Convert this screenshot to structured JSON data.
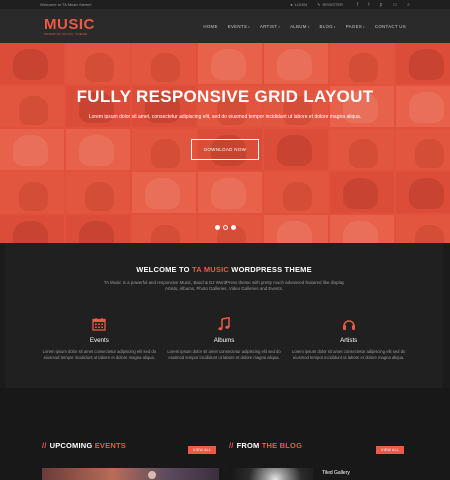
{
  "topbar": {
    "welcome": "Welcome to TA Music theme!",
    "login": "LOGIN",
    "register": "REGISTER",
    "social": [
      {
        "icon": "facebook-icon",
        "glyph": "f"
      },
      {
        "icon": "twitter-icon",
        "glyph": "t"
      },
      {
        "icon": "pinterest-icon",
        "glyph": "p"
      },
      {
        "icon": "cart-icon",
        "glyph": "▭"
      },
      {
        "icon": "search-icon",
        "glyph": "⌕"
      }
    ]
  },
  "header": {
    "logo": "MUSIC",
    "tagline": "PREMIUM MUSIC THEME"
  },
  "nav": [
    {
      "label": "HOME",
      "dropdown": false
    },
    {
      "label": "EVENTS",
      "dropdown": true
    },
    {
      "label": "ARTIST",
      "dropdown": true
    },
    {
      "label": "ALBUM",
      "dropdown": true
    },
    {
      "label": "BLOG",
      "dropdown": true
    },
    {
      "label": "PAGES",
      "dropdown": true
    },
    {
      "label": "CONTACT US",
      "dropdown": false
    }
  ],
  "hero": {
    "title": "FULLY RESPONSIVE GRID LAYOUT",
    "subtitle": "Lorem ipsum dolor sit amet, consectetur adipiscing elit, sed do eiusmod tempor incididunt ut labore et dolore magna aliqua.",
    "button": "DOWNLOAD NOW",
    "slides": 3,
    "active_slide": 2
  },
  "welcome": {
    "title_prefix": "WELCOME TO ",
    "title_accent": "TA MUSIC",
    "title_suffix": " WORDPRESS THEME",
    "description": "TA Music is a powerful and responsive Music, Band & DJ WordPress theme with pretty much advanced featured like display Artists, Albums, Photo Galleries, Video Galleries and Events."
  },
  "features": [
    {
      "icon": "calendar-icon",
      "title": "Events",
      "text": "Lorem ipsum dolor sit amet consectetur adipiscing elit sed do eiusmod tempor incididunt ut labore et dolore magna aliqua."
    },
    {
      "icon": "music-note-icon",
      "title": "Albums",
      "text": "Lorem ipsum dolor sit amet consectetur adipiscing elit sed do eiusmod tempor incididunt ut labore et dolore magna aliqua."
    },
    {
      "icon": "headphones-icon",
      "title": "Artists",
      "text": "Lorem ipsum dolor sit amet consectetur adipiscing elit sed do eiusmod tempor incididunt ut labore et dolore magna aliqua."
    }
  ],
  "upcoming": {
    "slash": "//",
    "title": "UPCOMING ",
    "accent": "EVENTS",
    "view_all": "VIEW ALL"
  },
  "blog": {
    "slash": "//",
    "title": "FROM ",
    "accent": "THE BLOG",
    "view_all": "VIEW ALL",
    "post_title": "Tiled Gallery"
  },
  "colors": {
    "accent": "#ea5a45",
    "hero_red": "#e2513c",
    "dark_panel": "#202020"
  }
}
